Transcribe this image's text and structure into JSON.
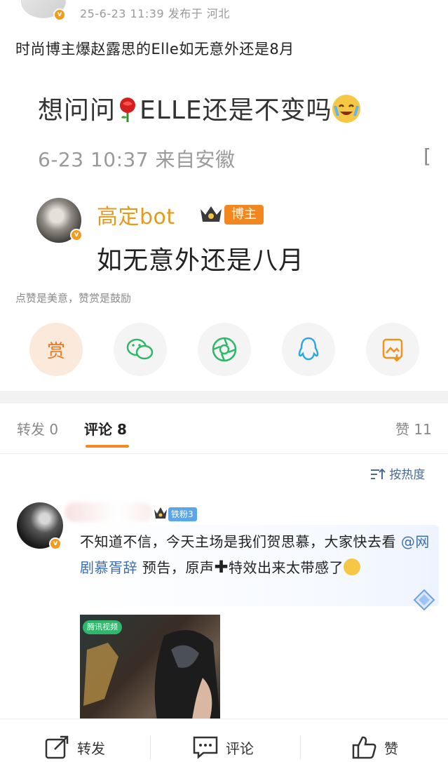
{
  "header": {
    "meta": "25-6-23 11:39  发布于 河北"
  },
  "post": {
    "text": "时尚博主爆赵露思的Elle如无意外还是8月"
  },
  "screenshot": {
    "question_prefix": "想问问",
    "question_suffix": "ELLE还是不变吗",
    "meta": "6-23 10:37 来自安徽",
    "bracket": "[",
    "reply_name": "高定bot",
    "reply_tag": "博主",
    "reply_text": "如无意外还是八月"
  },
  "like_hint": "点赞是美意，赞赏是鼓励",
  "share": {
    "reward_label": "赏",
    "icons": [
      "reward-icon",
      "wechat-icon",
      "moments-icon",
      "qq-icon",
      "save-image-icon"
    ]
  },
  "tabs": {
    "repost": "转发 0",
    "comment": "评论 8",
    "like": "赞 11"
  },
  "sort": {
    "label": "按热度"
  },
  "comment": {
    "fan_badge": "铁粉3",
    "text_a": "不知道不信，今天主场是我们贺思慕，大家快去看",
    "mention": "@网剧慕胥辞",
    "text_b": "预告，原声",
    "plus": "✚",
    "text_c": "特效出来太带感了",
    "video_badge": "腾讯视频"
  },
  "bottom_bar": {
    "repost": "转发",
    "comment": "评论",
    "like": "赞"
  },
  "colors": {
    "accent_orange": "#f08a24",
    "link_blue": "#3d6fb3",
    "gold_name": "#e39a1f"
  }
}
